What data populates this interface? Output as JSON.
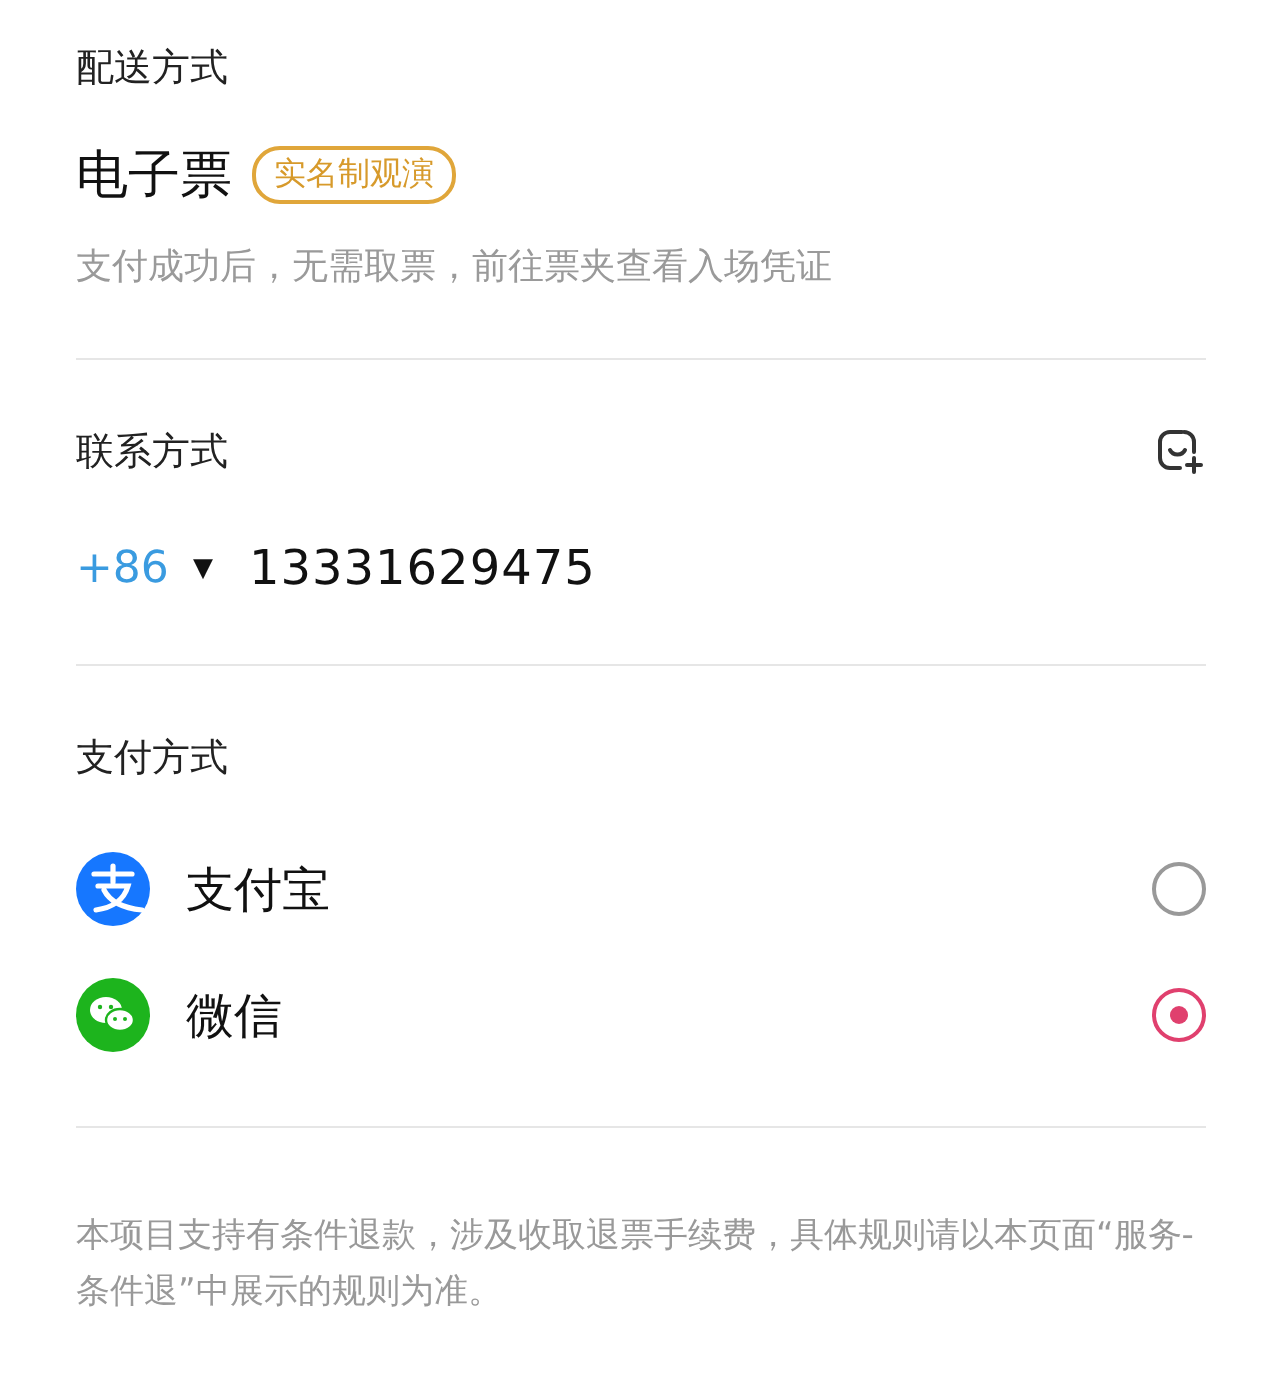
{
  "delivery": {
    "title": "配送方式",
    "ticket_type": "电子票",
    "badge": "实名制观演",
    "note": "支付成功后，无需取票，前往票夹查看入场凭证"
  },
  "contact": {
    "title": "联系方式",
    "country_code": "+86",
    "dropdown_glyph": "▼",
    "phone": "13331629475"
  },
  "payment": {
    "title": "支付方式",
    "methods": [
      {
        "kind": "alipay",
        "label": "支付宝",
        "selected": false
      },
      {
        "kind": "wechat",
        "label": "微信",
        "selected": true
      }
    ]
  },
  "notice": "本项目支持有条件退款，涉及收取退票手续费，具体规则请以本页面“服务-条件退”中展示的规则为准。"
}
